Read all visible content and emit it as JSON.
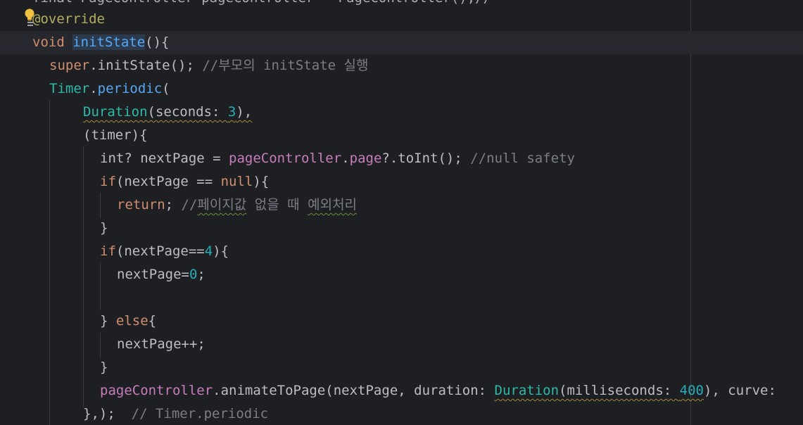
{
  "lines": [
    {
      "t0": "final PageController pageController = PageController();//"
    },
    {
      "override": "@override"
    },
    {
      "void": "void ",
      "fname": "initState",
      "rest": "(){"
    },
    {
      "super": "super",
      "rest": ".initState(); ",
      "cmt": "//부모의 initState 실행"
    },
    {
      "timer": "Timer",
      "dot": ".",
      "periodic": "periodic",
      "rest": "("
    },
    {
      "dur": "Duration",
      "rest1": "(seconds: ",
      "num": "3",
      "rest2": "),"
    },
    {
      "t": "(timer){"
    },
    {
      "a": "int? nextPage = ",
      "pc": "pageController",
      "dot": ".",
      "page": "page",
      "b": "?.toInt(); ",
      "cmt": "//null safety"
    },
    {
      "if": "if",
      "a": "(nextPage == ",
      "null": "null",
      "b": "){"
    },
    {
      "ret": "return",
      "semi": "; ",
      "cmt1": "//",
      "cmt2": "페이지값",
      "cmt3": " 없을 때 ",
      "cmt4": "예외처리"
    },
    {
      "t": "}"
    },
    {
      "if": "if",
      "a": "(nextPage==",
      "num": "4",
      "b": "){"
    },
    {
      "a": "nextPage=",
      "num": "0",
      "b": ";"
    },
    {
      "t": ""
    },
    {
      "a": "} ",
      "else": "else",
      "b": "{"
    },
    {
      "t": "nextPage++;"
    },
    {
      "t": "}"
    },
    {
      "pc": "pageController",
      "a": ".animateToPage(nextPage, duration: ",
      "dur": "Duration",
      "b": "(milliseconds: ",
      "num": "400",
      "c": "), curve:"
    },
    {
      "a": "},); ",
      "cmt": " // Timer.periodic"
    }
  ],
  "icons": {
    "intention": "lightbulb-icon"
  }
}
